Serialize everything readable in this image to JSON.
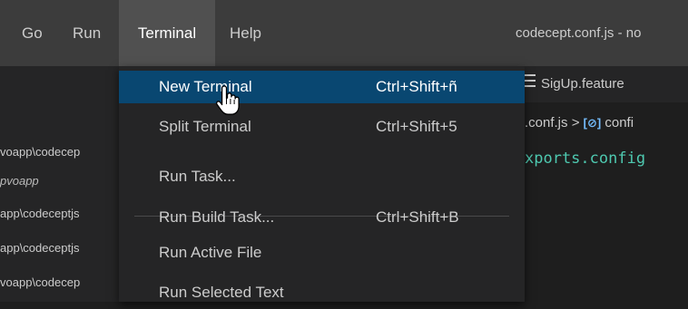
{
  "menubar": {
    "items": [
      {
        "label": "Go"
      },
      {
        "label": "Run"
      },
      {
        "label": "Terminal"
      },
      {
        "label": "Help"
      }
    ],
    "window_title": "codecept.conf.js - no"
  },
  "explorer": {
    "lines": [
      "voapp\\codecep",
      "pvoapp",
      "app\\codeceptjs",
      "app\\codeceptjs",
      "voapp\\codecep"
    ]
  },
  "editor": {
    "tab_label": "SigUp.feature",
    "breadcrumb_file": ".conf.js",
    "breadcrumb_sep": ">",
    "breadcrumb_symbol": "[⊘]",
    "breadcrumb_item": "confi",
    "code_line": "xports.config"
  },
  "dropdown": {
    "items": [
      {
        "label": "New Terminal",
        "shortcut": "Ctrl+Shift+ñ"
      },
      {
        "label": "Split Terminal",
        "shortcut": "Ctrl+Shift+5"
      },
      {
        "label": "Run Task...",
        "shortcut": ""
      },
      {
        "label": "Run Build Task...",
        "shortcut": "Ctrl+Shift+B"
      },
      {
        "label": "Run Active File",
        "shortcut": ""
      },
      {
        "label": "Run Selected Text",
        "shortcut": ""
      }
    ]
  },
  "colors": {
    "menu_highlight": "#094771",
    "menubar_bg": "#3c3c3c",
    "dropdown_bg": "#252526",
    "code_color": "#4ec9b0"
  }
}
